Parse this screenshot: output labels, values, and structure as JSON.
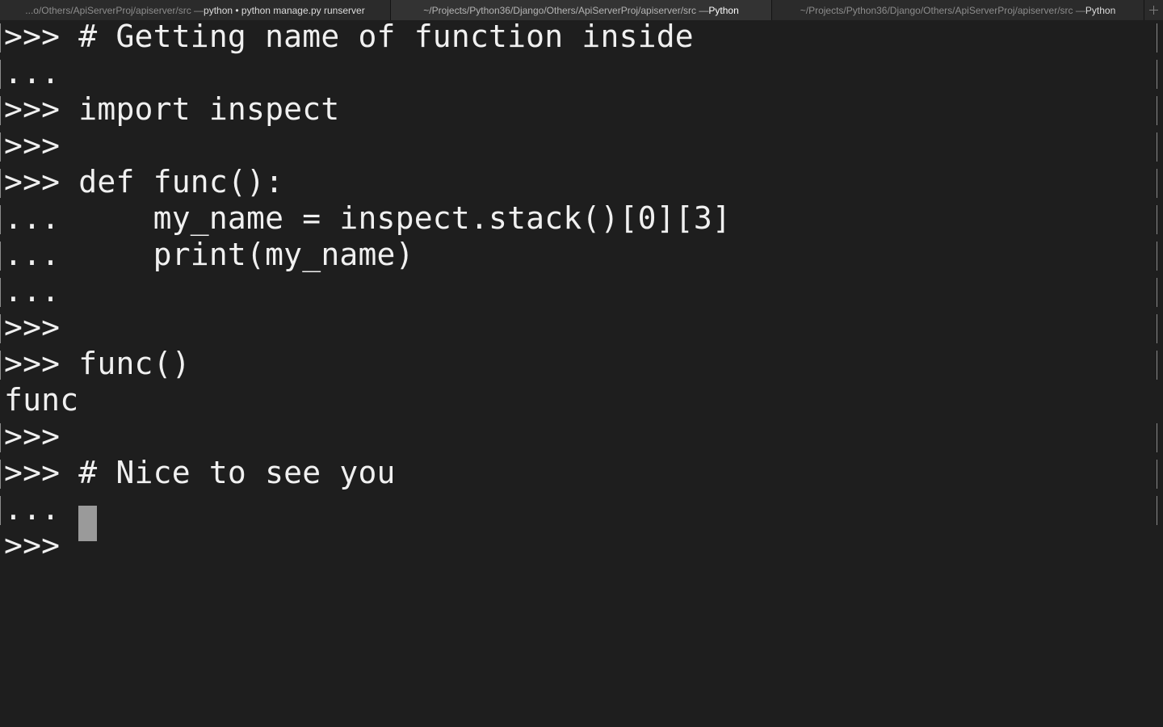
{
  "tabs": [
    {
      "path": "...o/Others/ApiServerProj/apiserver/src — ",
      "process": "python • python manage.py runserver",
      "active": false
    },
    {
      "path": "~/Projects/Python36/Django/Others/ApiServerProj/apiserver/src — ",
      "process": "Python",
      "active": true
    },
    {
      "path": "~/Projects/Python36/Django/Others/ApiServerProj/apiserver/src — ",
      "process": "Python",
      "active": false
    }
  ],
  "new_tab_icon": "plus-icon",
  "terminal": {
    "lines": [
      {
        "text": ">>> # Getting name of function inside",
        "marked": true
      },
      {
        "text": "...",
        "marked": true
      },
      {
        "text": ">>> import inspect",
        "marked": true
      },
      {
        "text": ">>>",
        "marked": true
      },
      {
        "text": ">>> def func():",
        "marked": true
      },
      {
        "text": "...     my_name = inspect.stack()[0][3]",
        "marked": true
      },
      {
        "text": "...     print(my_name)",
        "marked": true
      },
      {
        "text": "...",
        "marked": true
      },
      {
        "text": ">>>",
        "marked": true
      },
      {
        "text": ">>> func()",
        "marked": true
      },
      {
        "text": "func",
        "marked": false
      },
      {
        "text": ">>>",
        "marked": true
      },
      {
        "text": ">>> # Nice to see you",
        "marked": true
      },
      {
        "text": "...",
        "marked": true
      },
      {
        "text": ">>> ",
        "marked": false
      }
    ]
  },
  "colors": {
    "background": "#1e1e1e",
    "foreground": "#f0f0f0",
    "cursor": "#9a9a9a",
    "tabbar": "#2b2b2b"
  }
}
